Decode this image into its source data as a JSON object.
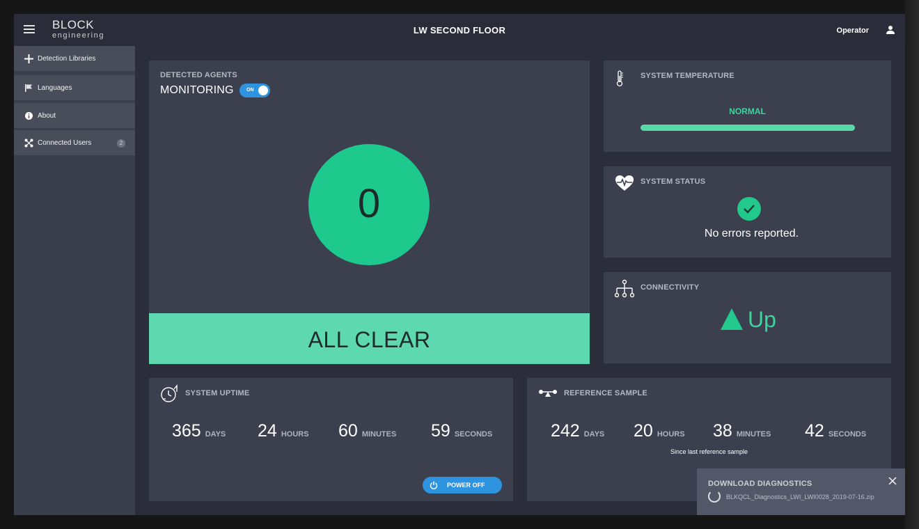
{
  "header": {
    "logo_line1": "BLOCK",
    "logo_line2": "engineering",
    "title": "LW SECOND FLOOR",
    "user_label": "Operator"
  },
  "sidebar": {
    "items": [
      {
        "label": "Detection Libraries",
        "icon": "plus-icon"
      },
      {
        "label": "Languages",
        "icon": "flag-icon"
      },
      {
        "label": "About",
        "icon": "info-icon"
      },
      {
        "label": "Connected Users",
        "icon": "network-icon",
        "badge": "2"
      }
    ]
  },
  "agents": {
    "label": "DETECTED AGENTS",
    "monitoring_label": "MONITORING",
    "toggle_state": "ON",
    "count": "0",
    "status_text": "ALL CLEAR"
  },
  "temperature": {
    "label": "SYSTEM TEMPERATURE",
    "value": "NORMAL",
    "icon": "thermometer-icon"
  },
  "system_status": {
    "label": "SYSTEM STATUS",
    "message": "No errors reported.",
    "icon": "heartbeat-icon"
  },
  "connectivity": {
    "label": "CONNECTIVITY",
    "value": "Up",
    "icon": "network-tree-icon"
  },
  "uptime": {
    "label": "SYSTEM UPTIME",
    "days": "365",
    "days_label": "DAYS",
    "hours": "24",
    "hours_label": "HOURS",
    "minutes": "60",
    "minutes_label": "MINUTES",
    "seconds": "59",
    "seconds_label": "SECONDS",
    "power_button": "POWER OFF"
  },
  "reference": {
    "label": "REFERENCE SAMPLE",
    "days": "242",
    "days_label": "DAYS",
    "hours": "20",
    "hours_label": "HOURS",
    "minutes": "38",
    "minutes_label": "MINUTES",
    "seconds": "42",
    "seconds_label": "SECONDS",
    "note": "Since last reference sample"
  },
  "toast": {
    "title": "DOWNLOAD DIAGNOSTICS",
    "filename": "BLKQCL_Diagnostics_LWI_LWI0028_2019-07-16.zip"
  },
  "colors": {
    "accent_green": "#1dc98d",
    "clear_green": "#5ed8ae",
    "toggle_blue": "#2f94e0",
    "card_bg": "#3c3f4d"
  }
}
